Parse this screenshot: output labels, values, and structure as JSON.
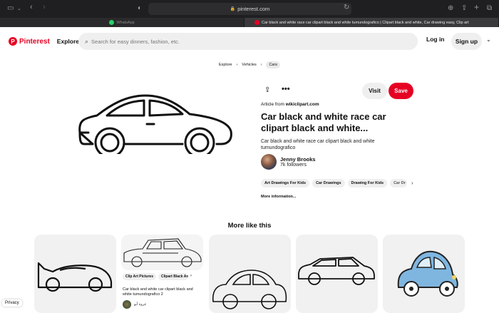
{
  "browser": {
    "url": "pinterest.com",
    "tabs": [
      {
        "label": "WhatsApp",
        "active": false
      },
      {
        "label": "Car black and white race car clipart black and white tumundografico | Clipart black and white, Car drawing easy, Clip art",
        "active": true
      }
    ]
  },
  "header": {
    "logo": "Pinterest",
    "explore": "Explore",
    "search_placeholder": "Search for easy dinners, fashion, etc.",
    "login": "Log in",
    "signup": "Sign up"
  },
  "breadcrumb": [
    "Explore",
    "Vehicles",
    "Cars"
  ],
  "pin": {
    "visit": "Visit",
    "save": "Save",
    "source_prefix": "Article from",
    "source": "wikiclipart.com",
    "title": "Car black and white race car clipart black and white...",
    "description": "Car black and white race car clipart black and white tumundografico",
    "author": {
      "name": "Jenny Brooks",
      "followers": "7k followers"
    },
    "chips": [
      "Art Drawings For Kids",
      "Car Drawings",
      "Drawing For Kids",
      "Car Dr"
    ],
    "more_info": "More information..."
  },
  "more_like": {
    "heading": "More like this",
    "card2": {
      "chips": [
        "Clip Art Pictures",
        "Clipart Black An"
      ],
      "title": "Car black and white car clipart black and white tumundografico 2",
      "author": "عروة أبو"
    }
  },
  "footer": {
    "privacy": "Privacy"
  },
  "colors": {
    "brand": "#e60023",
    "chrome": "#1f1f21"
  }
}
